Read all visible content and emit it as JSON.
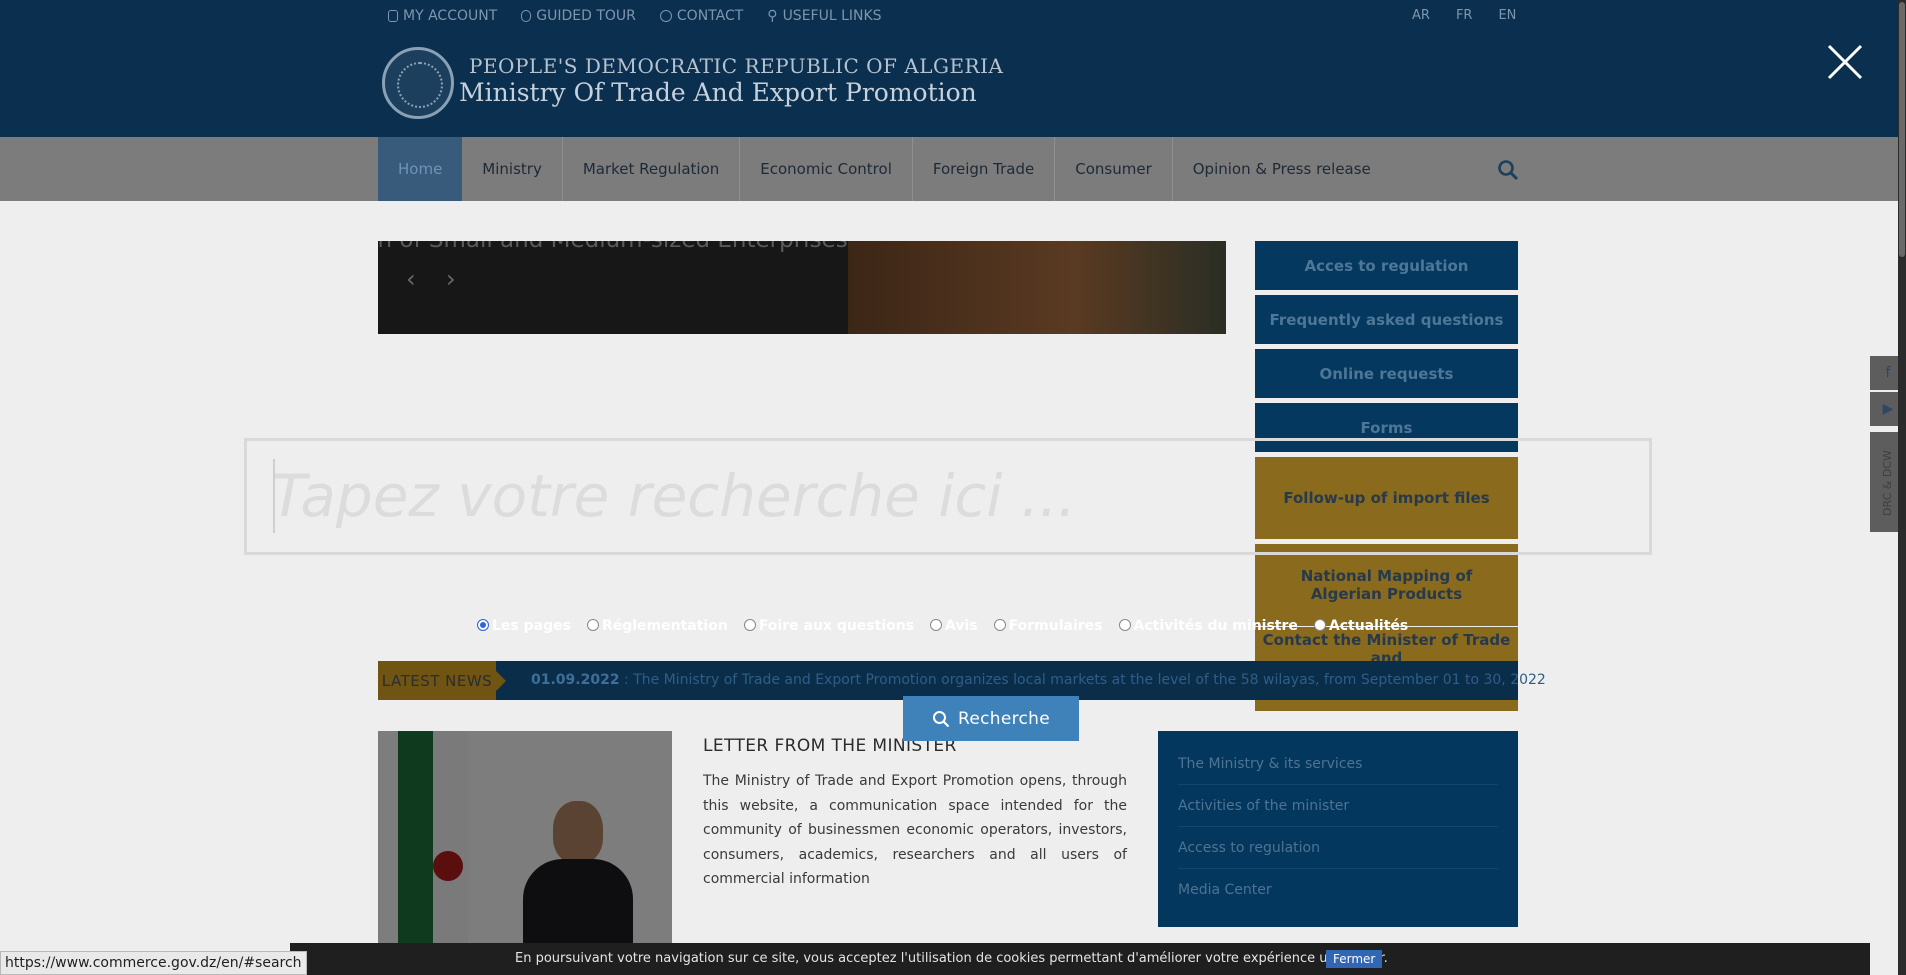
{
  "topbar": {
    "links": [
      {
        "label": "MY ACCOUNT",
        "icon": "lock-icon"
      },
      {
        "label": "GUIDED TOUR",
        "icon": "mouse-icon"
      },
      {
        "label": "CONTACT",
        "icon": "info-icon"
      },
      {
        "label": "USEFUL LINKS",
        "icon": "link-icon"
      }
    ],
    "languages": [
      "AR",
      "FR",
      "EN"
    ]
  },
  "brand": {
    "line1": "PEOPLE'S DEMOCRATIC REPUBLIC OF ALGERIA",
    "line2": "Ministry Of Trade And Export Promotion"
  },
  "nav": {
    "items": [
      "Home",
      "Ministry",
      "Market Regulation",
      "Economic Control",
      "Foreign Trade",
      "Consumer",
      "Opinion & Press release"
    ],
    "active": "Home"
  },
  "slider": {
    "caption": "tion of Small and Medium-sized Enterprises"
  },
  "sidebar": {
    "buttons": [
      "Acces to regulation",
      "Frequently asked questions",
      "Online requests",
      "Forms",
      "Follow-up of import files",
      "National Mapping of Algerian Products",
      "Contact the Minister of Trade and"
    ]
  },
  "social": {
    "vertical_text": "DRC & DCW"
  },
  "news": {
    "label": "LATEST NEWS",
    "date": "01.09.2022",
    "text": " : The Ministry of Trade and Export Promotion organizes local markets at the level of the 58 wilayas, from September 01 to 30, 2022"
  },
  "letter": {
    "title": "LETTER FROM THE MINISTER",
    "body": "The Ministry of Trade and Export Promotion opens, through this website, a communication space intended for the community of businessmen economic operators, investors, consumers, academics, researchers and all users of commercial information"
  },
  "side_menu": {
    "items": [
      "The Ministry & its services",
      "Activities of the minister",
      "Access to regulation",
      "Media Center"
    ]
  },
  "search": {
    "placeholder": "Tapez votre recherche ici ...",
    "filters": [
      "Les pages",
      "Réglementation",
      "Foire aux questions",
      "Avis",
      "Formulaires",
      "Activités du ministre",
      "Actualités"
    ],
    "selected": "Les pages",
    "button_label": "Recherche"
  },
  "status_url": "https://www.commerce.gov.dz/en/#search",
  "cookie": {
    "message": "En poursuivant votre navigation sur ce site, vous acceptez l'utilisation de cookies permettant d'améliorer votre expérience utilisateur.",
    "button": "Fermer"
  }
}
